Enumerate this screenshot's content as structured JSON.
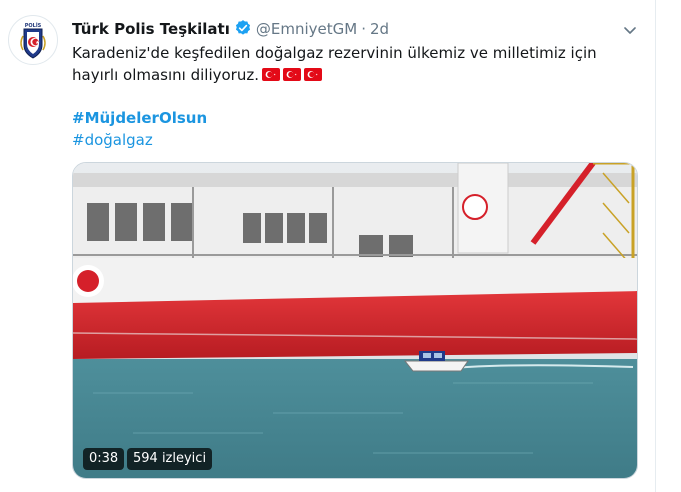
{
  "tweet": {
    "author_name": "Türk Polis Teşkilatı",
    "handle": "@EmniyetGM",
    "separator": "·",
    "time": "2d",
    "text": "Karadeniz'de keşfedilen doğalgaz rezervinin ülkemiz ve milletimiz için hayırlı olmasını diliyoruz.",
    "flag_count": 3,
    "hashtags": [
      "#MüjdelerOlsun",
      "#doğalgaz"
    ]
  },
  "media": {
    "duration": "0:38",
    "views": "594 izleyici"
  },
  "icons": {
    "verified": "verified-badge-icon",
    "caret": "chevron-down-icon",
    "flag": "turkey-flag-icon"
  },
  "colors": {
    "link": "#1b95e0",
    "verified": "#1da1f2",
    "secondary_text": "#657786",
    "hull_red": "#d5202a"
  }
}
